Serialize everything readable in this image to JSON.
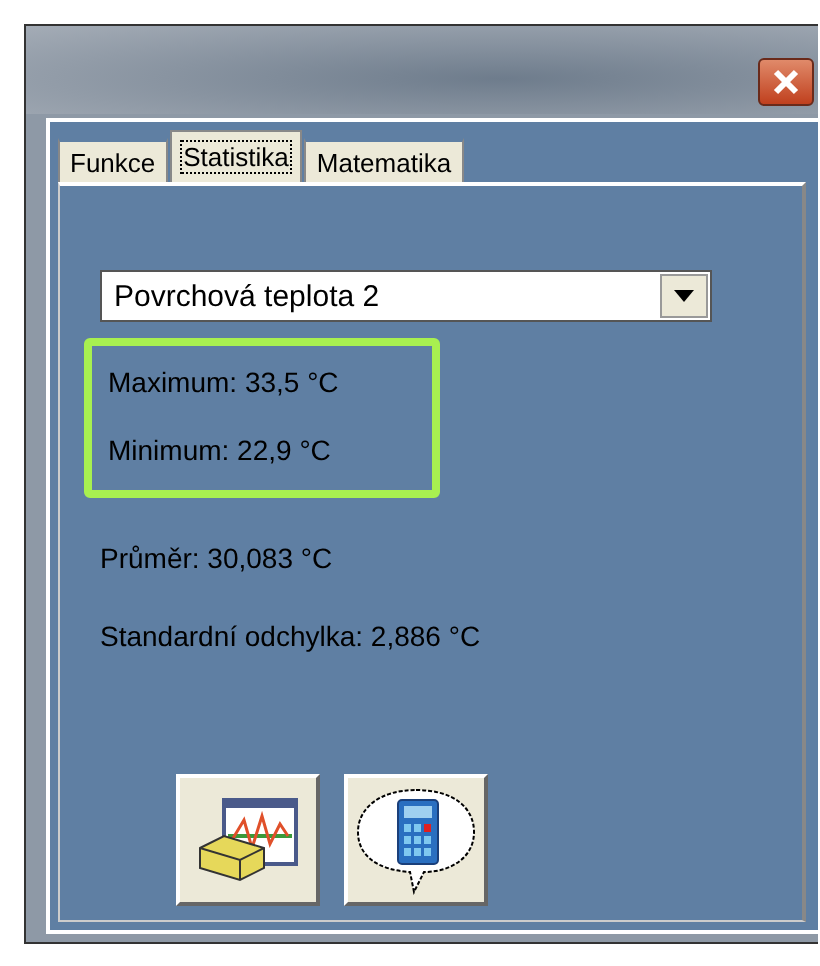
{
  "tabs": [
    {
      "label": "Funkce",
      "selected": false
    },
    {
      "label": "Statistika",
      "selected": true
    },
    {
      "label": "Matematika",
      "selected": false
    }
  ],
  "dropdown": {
    "value": "Povrchová teplota  2"
  },
  "stats": [
    {
      "text": "Maximum: 33,5 °C",
      "highlighted": true
    },
    {
      "text": "Minimum: 22,9 °C",
      "highlighted": true
    },
    {
      "text": "Průměr: 30,083 °C",
      "highlighted": false
    },
    {
      "text": "Standardní odchylka: 2,886 °C",
      "highlighted": false
    }
  ],
  "buttons": [
    {
      "kind": "clear-chart"
    },
    {
      "kind": "calculator"
    }
  ]
}
